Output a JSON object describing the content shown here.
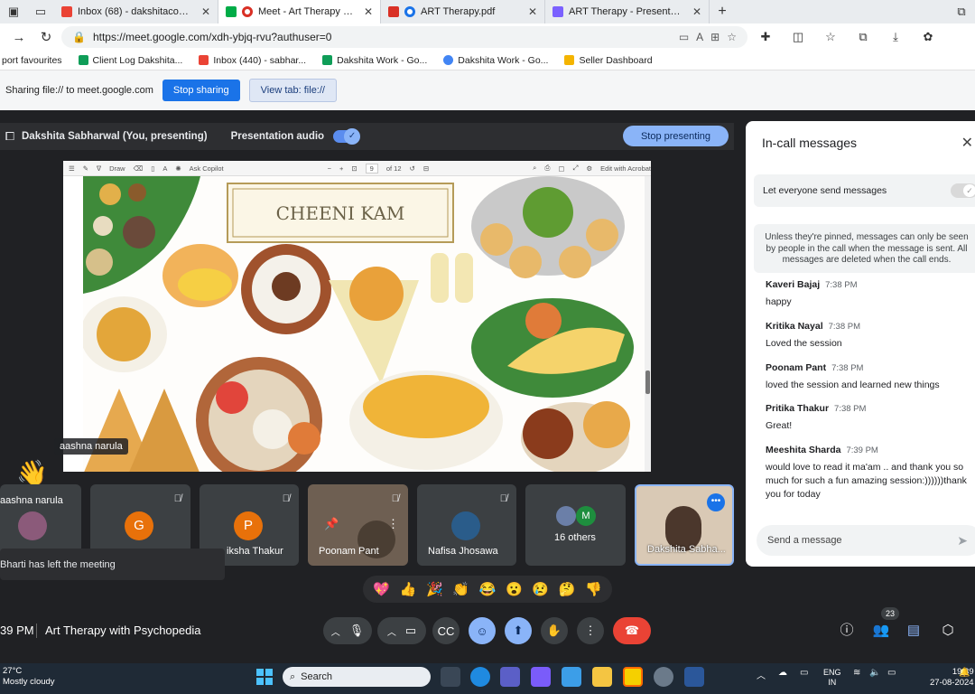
{
  "browser": {
    "tabs": [
      {
        "title": "Inbox (68) - dakshitacounselling@",
        "icon_color": "#ea4335"
      },
      {
        "title": "Meet - Art Therapy with Psyc",
        "icon_color": "#00ac47"
      },
      {
        "title": "ART Therapy.pdf",
        "icon_color": "#d93025"
      },
      {
        "title": "ART Therapy - Presentation",
        "icon_color": "#7b61ff"
      }
    ],
    "url": "https://meet.google.com/xdh-ybjq-rvu?authuser=0",
    "favourites": [
      {
        "label": "port favourites",
        "color": "#777777"
      },
      {
        "label": "Client Log Dakshita...",
        "color": "#0f9d58"
      },
      {
        "label": "Inbox (440) - sabhar...",
        "color": "#ea4335"
      },
      {
        "label": "Dakshita Work - Go...",
        "color": "#0f9d58"
      },
      {
        "label": "Dakshita Work - Go...",
        "color": "#4285f4"
      },
      {
        "label": "Seller Dashboard",
        "color": "#f4b400"
      }
    ]
  },
  "sharing": {
    "status_text": "Sharing file:// to meet.google.com",
    "stop_label": "Stop sharing",
    "view_tab_label": "View tab: file://"
  },
  "presenting": {
    "presenter_label": "Dakshita Sabharwal (You, presenting)",
    "audio_label": "Presentation audio",
    "audio_on": true,
    "stop_label": "Stop presenting"
  },
  "pdf_viewer": {
    "draw_label": "Draw",
    "copilot_label": "Ask Copilot",
    "page_current": "9",
    "page_total": "of 12",
    "edit_label": "Edit with Acrobat"
  },
  "slide": {
    "title": "CHEENI KAM"
  },
  "pinned_participant": {
    "name": "aashna narula",
    "reaction": "👋"
  },
  "participants": [
    {
      "name": "aashna narula",
      "muted": false,
      "avatar_letter": "",
      "avatar_color": "#8b5a7a"
    },
    {
      "name": "",
      "muted": true,
      "avatar_letter": "G",
      "avatar_color": "#e8710a"
    },
    {
      "name": "iksha Thakur",
      "muted": true,
      "avatar_letter": "P",
      "avatar_color": "#e8710a"
    },
    {
      "name": "Poonam Pant",
      "muted": true,
      "avatar_letter": "",
      "avatar_color": "#7a6d5f"
    },
    {
      "name": "Nafisa Jhosawa",
      "muted": true,
      "avatar_letter": "",
      "avatar_color": "#2a5c8a"
    },
    {
      "name": "16 others",
      "muted": false,
      "avatar_letter": "M",
      "avatar_color": "#1e8e3e"
    },
    {
      "name": "Dakshita Sabha...",
      "muted": false,
      "avatar_letter": "",
      "avatar_color": "#d9c9b5"
    }
  ],
  "toast": "Bharti has left the meeting",
  "reactions": [
    "💖",
    "👍",
    "🎉",
    "👏",
    "😂",
    "😮",
    "😢",
    "🤔",
    "👎"
  ],
  "meeting": {
    "time": "39 PM",
    "title": "Art Therapy with Psychopedia",
    "participant_count": "23"
  },
  "chat": {
    "title": "In-call messages",
    "let_everyone_label": "Let everyone send messages",
    "pin_note": "Unless they're pinned, messages can only be seen by people in the call when the message is sent. All messages are deleted when the call ends.",
    "messages": [
      {
        "sender": "Kaveri Bajaj",
        "time": "7:38 PM",
        "text": "happy"
      },
      {
        "sender": "Kritika Nayal",
        "time": "7:38 PM",
        "text": "Loved the session"
      },
      {
        "sender": "Poonam Pant",
        "time": "7:38 PM",
        "text": "loved the session and learned new things"
      },
      {
        "sender": "Pritika Thakur",
        "time": "7:38 PM",
        "text": "Great!"
      },
      {
        "sender": "Meeshita Sharda",
        "time": "7:39 PM",
        "text": "would love to read it ma'am .. and thank you so much for such a fun amazing session:))))))thank you for today"
      }
    ],
    "input_placeholder": "Send a message"
  },
  "taskbar": {
    "temperature": "27°C",
    "weather": "Mostly cloudy",
    "search_label": "Search",
    "lang_top": "ENG",
    "lang_bottom": "IN",
    "time": "19:39",
    "date": "27-08-2024"
  }
}
